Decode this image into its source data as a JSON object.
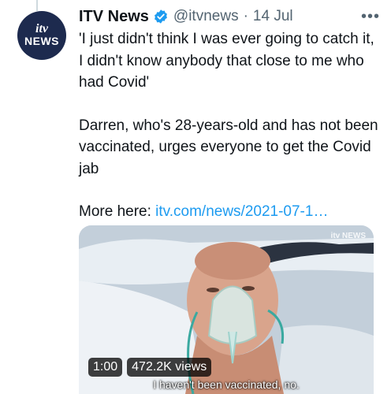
{
  "tweet": {
    "author_name": "ITV News",
    "handle": "@itvnews",
    "separator": "·",
    "date": "14 Jul",
    "more_label": "•••",
    "avatar": {
      "logo_top": "itv",
      "logo_bottom": "NEWS"
    },
    "paragraphs": [
      "'I just didn't think I was ever going to catch it, I didn't know anybody that close to me who had Covid'",
      "Darren, who's 28-years-old and has not been vaccinated, urges everyone to get the Covid jab"
    ],
    "link_prefix": "More here: ",
    "link_text": "itv.com/news/2021-07-1…",
    "verified_color": "#1d9bf0"
  },
  "media": {
    "watermark": "itv NEWS",
    "subtitle": "I haven't been vaccinated, no.",
    "duration": "1:00",
    "views": "472.2K views"
  }
}
